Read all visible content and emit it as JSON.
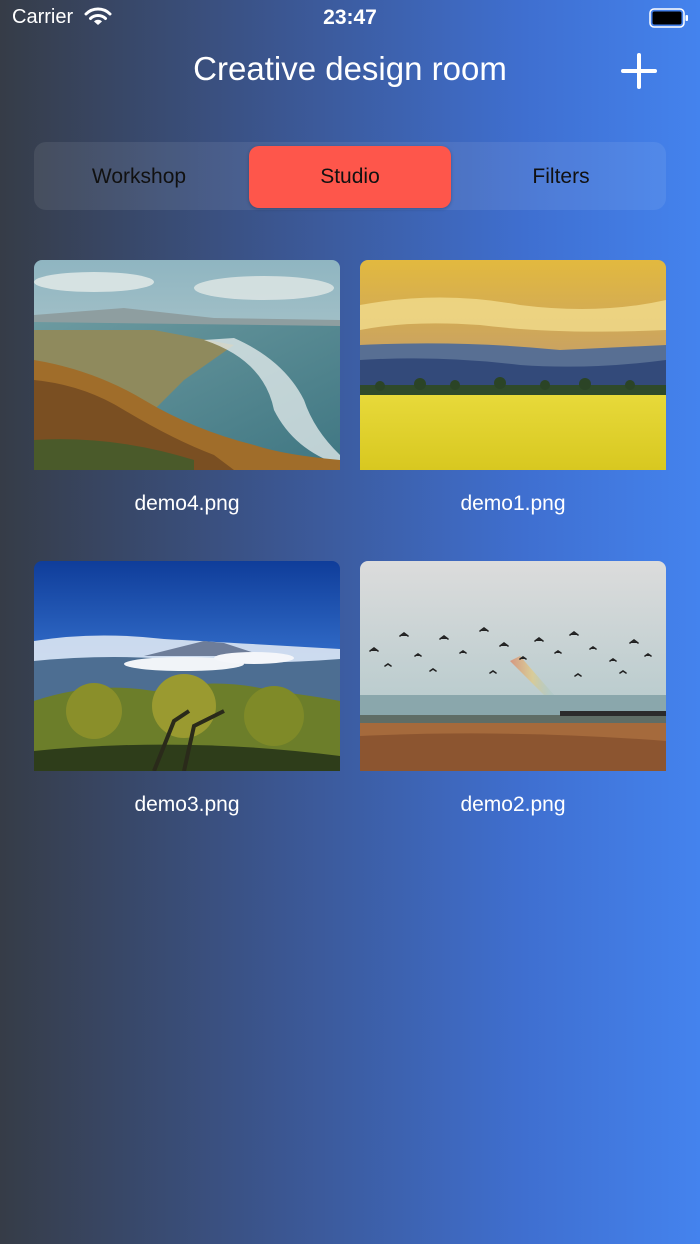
{
  "status_bar": {
    "carrier": "Carrier",
    "time": "23:47"
  },
  "header": {
    "title": "Creative design room",
    "add_icon": "plus-icon"
  },
  "segments": [
    {
      "label": "Workshop",
      "selected": false
    },
    {
      "label": "Studio",
      "selected": true
    },
    {
      "label": "Filters",
      "selected": false
    }
  ],
  "images": [
    {
      "name": "demo4.png",
      "scene": "coastal cliffs and ocean"
    },
    {
      "name": "demo1.png",
      "scene": "yellow field under sunset sky"
    },
    {
      "name": "demo3.png",
      "scene": "mountain above clouds with trees"
    },
    {
      "name": "demo2.png",
      "scene": "birds over sea with rainbow"
    }
  ],
  "colors": {
    "accent": "#fe564b",
    "background_start": "#363c47",
    "background_end": "#4483ee"
  }
}
